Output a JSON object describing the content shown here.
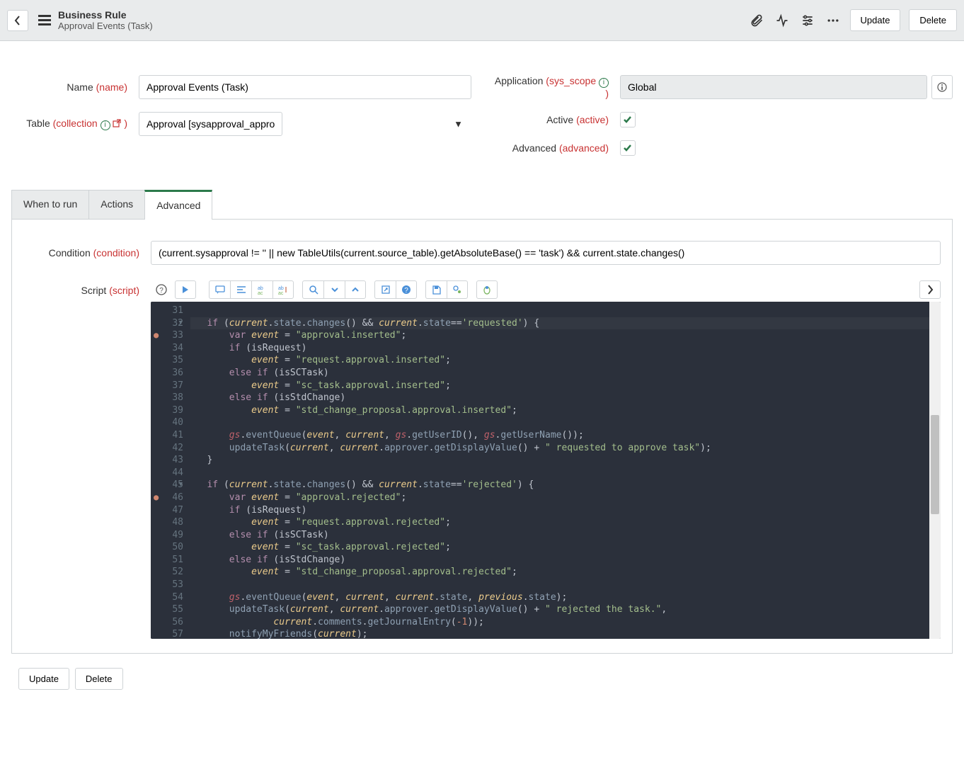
{
  "header": {
    "record_type": "Business Rule",
    "record_name": "Approval Events (Task)",
    "update": "Update",
    "delete": "Delete"
  },
  "form": {
    "name_label": "Name",
    "name_tech": "(name)",
    "name_value": "Approval Events (Task)",
    "table_label": "Table",
    "table_tech": "(collection",
    "table_value": "Approval [sysapproval_approver]",
    "application_label": "Application",
    "application_tech": "(sys_scope",
    "application_value": "Global",
    "active_label": "Active",
    "active_tech": "(active)",
    "advanced_label": "Advanced",
    "advanced_tech": "(advanced)"
  },
  "tabs": {
    "when": "When to run",
    "actions": "Actions",
    "advanced": "Advanced"
  },
  "advanced_tab": {
    "condition_label": "Condition",
    "condition_tech": "(condition)",
    "condition_value": "(current.sysapproval != '' || new TableUtils(current.source_table).getAbsoluteBase() == 'task') && current.state.changes()",
    "script_label": "Script",
    "script_tech": "(script)"
  },
  "editor": {
    "first_line": 31,
    "lines": [
      "",
      "if (current.state.changes() && current.state=='requested') {",
      "    var event = \"approval.inserted\";",
      "    if (isRequest)",
      "        event = \"request.approval.inserted\";",
      "    else if (isSCTask)",
      "        event = \"sc_task.approval.inserted\";",
      "    else if (isStdChange)",
      "        event = \"std_change_proposal.approval.inserted\";",
      "",
      "    gs.eventQueue(event, current, gs.getUserID(), gs.getUserName());",
      "    updateTask(current, current.approver.getDisplayValue() + \" requested to approve task\");",
      "}",
      "",
      "if (current.state.changes() && current.state=='rejected') {",
      "    var event = \"approval.rejected\";",
      "    if (isRequest)",
      "        event = \"request.approval.rejected\";",
      "    else if (isSCTask)",
      "        event = \"sc_task.approval.rejected\";",
      "    else if (isStdChange)",
      "        event = \"std_change_proposal.approval.rejected\";",
      "",
      "    gs.eventQueue(event, current, current.state, previous.state);",
      "    updateTask(current, current.approver.getDisplayValue() + \" rejected the task.\",",
      "            current.comments.getJournalEntry(-1));",
      "    notifyMyFriends(current);"
    ],
    "warning_lines": [
      33,
      46
    ],
    "fold_lines": [
      32,
      45
    ],
    "highlight_line": 32
  },
  "footer": {
    "update": "Update",
    "delete": "Delete"
  }
}
